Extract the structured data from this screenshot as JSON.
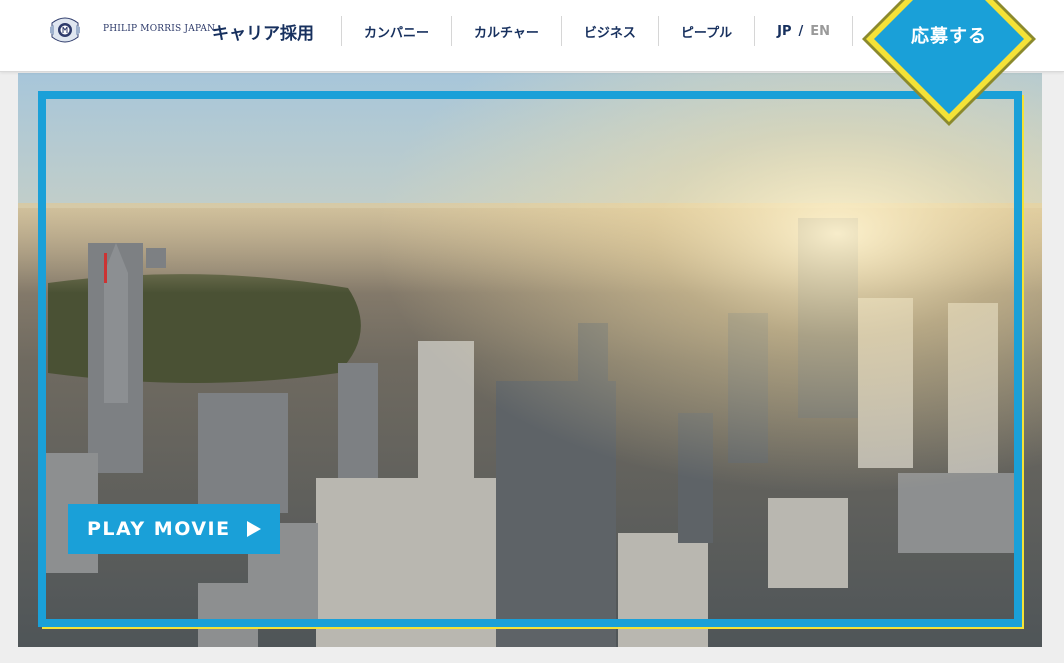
{
  "header": {
    "brand_text": "PHILIP MORRIS JAPAN",
    "career_title": "キャリア採用",
    "nav": [
      {
        "label": "カンパニー"
      },
      {
        "label": "カルチャー"
      },
      {
        "label": "ビジネス"
      },
      {
        "label": "ピープル"
      }
    ],
    "lang": {
      "jp": "JP",
      "separator": "/",
      "en": "EN"
    }
  },
  "apply": {
    "label": "応募する",
    "icon": "chevron-right-icon"
  },
  "hero": {
    "play_label": "PLAY MOVIE",
    "play_icon": "play-icon"
  },
  "colors": {
    "accent_blue": "#1aa0d8",
    "accent_yellow": "#f4e237",
    "navy": "#17305e"
  }
}
